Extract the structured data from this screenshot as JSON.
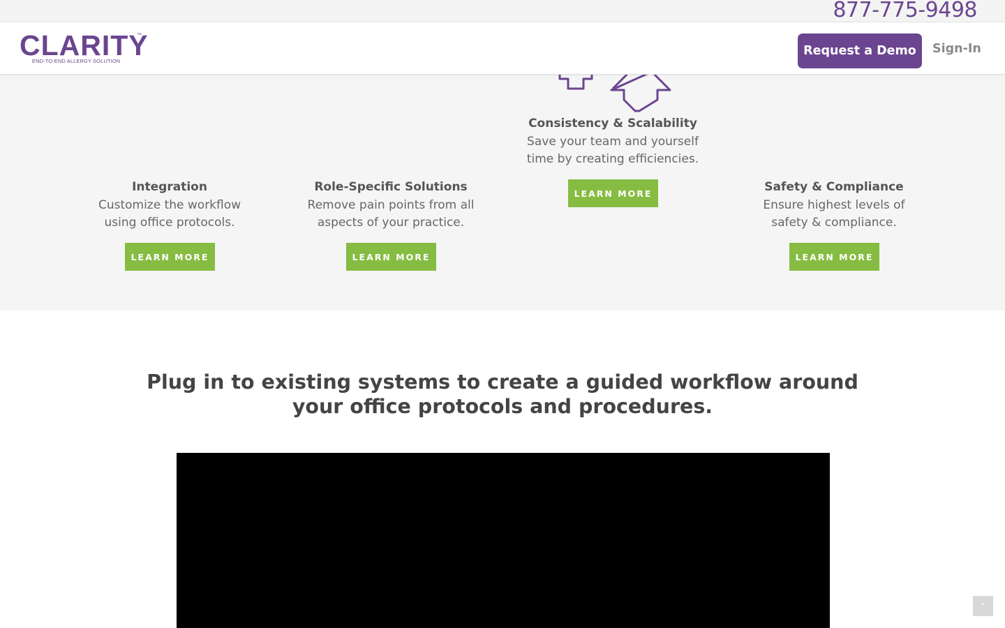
{
  "topbar": {
    "phone": "877-775-9498"
  },
  "header": {
    "logo": {
      "word": "CLARITY",
      "tm": "™",
      "tagline": "END-TO-END ALLERGY SOLUTION"
    },
    "demo_label": "Request a Demo",
    "signin_label": "Sign-In"
  },
  "features": [
    {
      "title": "Integration",
      "desc_line1": "Customize the workflow",
      "desc_line2": "using office protocols.",
      "button": "LEARN MORE"
    },
    {
      "title": "Role-Specific Solutions",
      "desc_line1": "Remove pain points from all",
      "desc_line2": "aspects of your practice.",
      "button": "LEARN MORE"
    },
    {
      "title": "Consistency & Scalability",
      "desc_line1": "Save your team and yourself",
      "desc_line2": "time by creating efficiencies.",
      "button": "LEARN MORE"
    },
    {
      "title": "Safety & Compliance",
      "desc_line1": "Ensure highest levels of",
      "desc_line2": "safety & compliance.",
      "button": "LEARN MORE"
    }
  ],
  "headline": {
    "line1": "Plug in to existing systems to create a guided workflow around",
    "line2": "your office protocols and procedures."
  },
  "icons": {
    "arrows": "arrows-up-icon",
    "to_top": "chevron-up-icon"
  },
  "colors": {
    "brand_purple": "#6b4590",
    "accent_green": "#86bc42"
  }
}
